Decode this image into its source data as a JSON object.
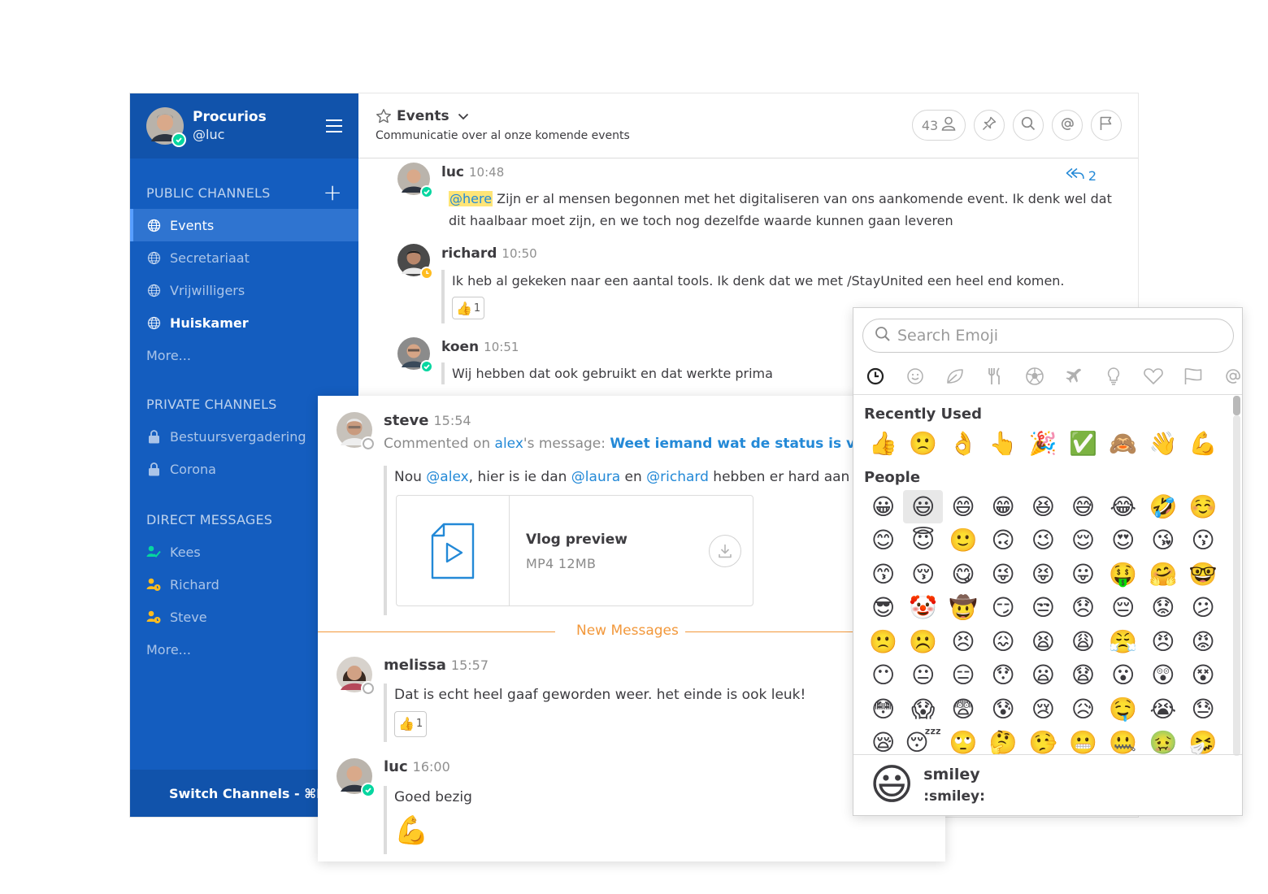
{
  "team": {
    "name": "Procurios",
    "username": "@luc"
  },
  "sidebar": {
    "public_title": "PUBLIC CHANNELS",
    "public_channels": [
      {
        "label": "Events"
      },
      {
        "label": "Secretariaat"
      },
      {
        "label": "Vrijwilligers"
      },
      {
        "label": "Huiskamer"
      }
    ],
    "public_more": "More...",
    "private_title": "PRIVATE CHANNELS",
    "private_channels": [
      {
        "label": "Bestuursvergadering"
      },
      {
        "label": "Corona"
      }
    ],
    "dm_title": "DIRECT MESSAGES",
    "direct_messages": [
      {
        "label": "Kees"
      },
      {
        "label": "Richard"
      },
      {
        "label": "Steve"
      }
    ],
    "dm_more": "More...",
    "switch_label": "Switch Channels - ⌘K"
  },
  "channel": {
    "name": "Events",
    "purpose": "Communicatie over al onze komende events",
    "member_count": "43"
  },
  "posts": [
    {
      "user": "luc",
      "time": "10:48",
      "mention": "@here",
      "text": "Zijn er al mensen begonnen met het digitaliseren van ons aankomende event. Ik denk wel dat dit haalbaar moet zijn, en we toch nog dezelfde waarde kunnen gaan leveren",
      "reply_count": "2"
    },
    {
      "user": "richard",
      "time": "10:50",
      "text": "Ik heb al gekeken naar een aantal tools. Ik denk dat we met /StayUnited een heel end komen.",
      "reaction_emoji": "👍",
      "reaction_count": "1"
    },
    {
      "user": "koen",
      "time": "10:51",
      "text": "Wij hebben dat ook gebruikt en dat werkte prima"
    }
  ],
  "thread": {
    "steve": {
      "user": "steve",
      "time": "15:54",
      "commented_prefix": "Commented on ",
      "commented_user": "alex",
      "commented_mid": "'s message: ",
      "commented_msg": "Weet iemand wat de status is van het",
      "text_1": "Nou ",
      "mention_1": "@alex",
      "text_2": ", hier is ie dan ",
      "mention_2": "@laura",
      "text_3": " en ",
      "mention_3": "@richard",
      "text_4": " hebben er hard aan gewerkt",
      "file_name": "Vlog preview",
      "file_meta": "MP4 12MB"
    },
    "new_messages_label": "New Messages",
    "melissa": {
      "user": "melissa",
      "time": "15:57",
      "text": "Dat is echt heel gaaf geworden weer. het einde is ook leuk!",
      "reaction_emoji": "👍",
      "reaction_count": "1"
    },
    "luc": {
      "user": "luc",
      "time": "16:00",
      "text": "Goed bezig",
      "emoji": "💪"
    }
  },
  "emoji_picker": {
    "search_placeholder": "Search Emoji",
    "categories": [
      "recent-icon",
      "people-icon",
      "nature-icon",
      "food-icon",
      "activity-icon",
      "travel-icon",
      "objects-icon",
      "symbols-icon",
      "flags-icon",
      "custom-icon"
    ],
    "recent_label": "Recently Used",
    "recent": [
      "👍",
      "🙁",
      "👌",
      "👆",
      "🎉",
      "✅",
      "🙈",
      "👋",
      "💪"
    ],
    "people_label": "People",
    "people": [
      "😀",
      "😃",
      "😄",
      "😁",
      "😆",
      "😅",
      "😂",
      "🤣",
      "☺️",
      "😊",
      "😇",
      "🙂",
      "🙃",
      "😉",
      "😌",
      "😍",
      "😘",
      "😗",
      "😙",
      "😚",
      "😋",
      "😜",
      "😝",
      "😛",
      "🤑",
      "🤗",
      "🤓",
      "😎",
      "🤡",
      "🤠",
      "😏",
      "😒",
      "😞",
      "😔",
      "😟",
      "😕",
      "🙁",
      "☹️",
      "😣",
      "😖",
      "😫",
      "😩",
      "😤",
      "😠",
      "😡",
      "😶",
      "😐",
      "😑",
      "😯",
      "😦",
      "😧",
      "😮",
      "😲",
      "😵",
      "😳",
      "😱",
      "😨",
      "😰",
      "😢",
      "😥",
      "🤤",
      "😭",
      "😓",
      "😪",
      "😴",
      "🙄",
      "🤔",
      "🤥",
      "😬",
      "🤐",
      "🤢",
      "🤧"
    ],
    "selected_index": 1,
    "preview_emoji": "😃",
    "preview_name": "smiley",
    "preview_alias": ":smiley:"
  },
  "colors": {
    "sidebar": "#145dbf",
    "accent": "#2389d7",
    "online": "#06d6a0",
    "away": "#ffbc1f",
    "new_messages": "#f2983b"
  }
}
